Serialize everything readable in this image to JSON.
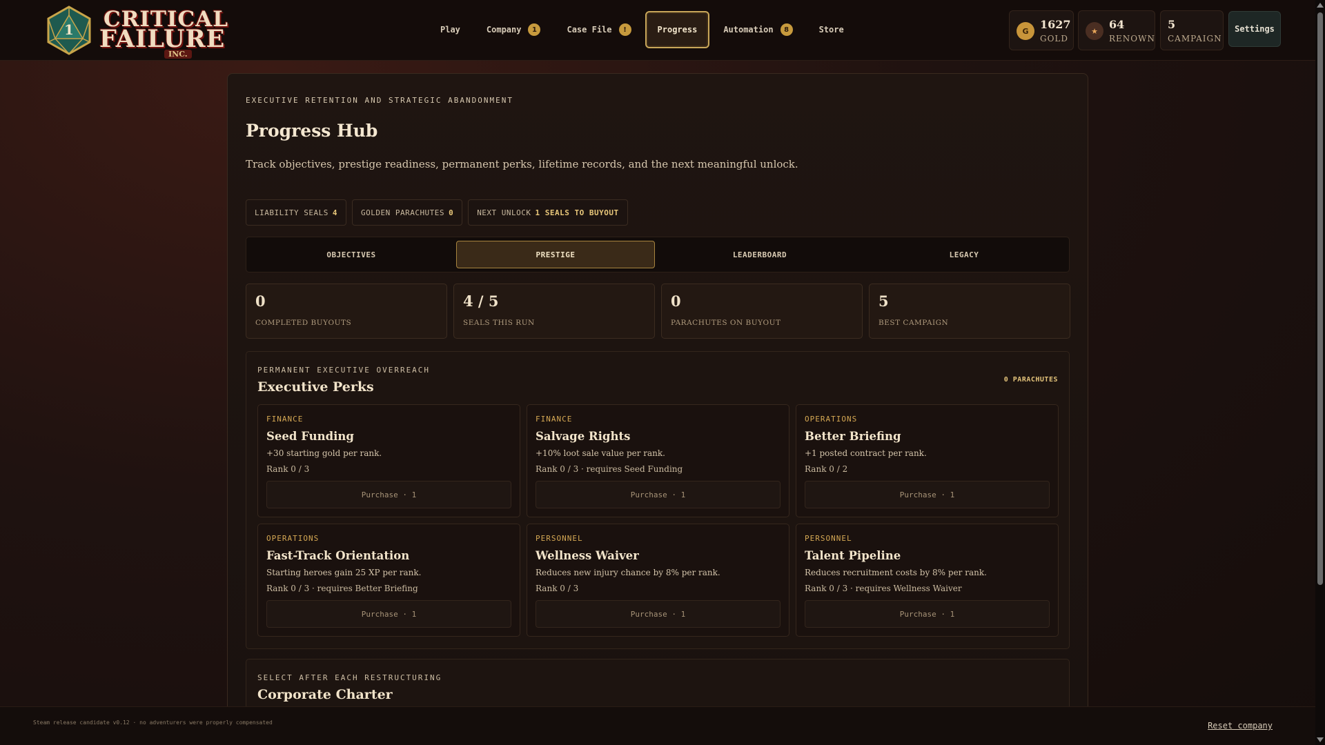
{
  "logo": {
    "line1": "CRITICAL",
    "line2": "FAILURE",
    "inc": "INC.",
    "die_number": "1"
  },
  "nav": [
    {
      "label": "Play",
      "badge": ""
    },
    {
      "label": "Company",
      "badge": "1"
    },
    {
      "label": "Case File",
      "badge": "!"
    },
    {
      "label": "Progress",
      "badge": "",
      "active": true
    },
    {
      "label": "Automation",
      "badge": "8"
    },
    {
      "label": "Store",
      "badge": ""
    }
  ],
  "stats": {
    "gold": {
      "value": "1627",
      "label": "GOLD",
      "icon": "G"
    },
    "renown": {
      "value": "64",
      "label": "RENOWN",
      "icon": "★"
    },
    "campaign": {
      "value": "5",
      "label": "CAMPAIGN"
    }
  },
  "settings_label": "Settings",
  "hub": {
    "eyebrow": "EXECUTIVE RETENTION AND STRATEGIC ABANDONMENT",
    "title": "Progress Hub",
    "description": "Track objectives, prestige readiness, permanent perks, lifetime records, and the next meaningful unlock.",
    "chips": [
      {
        "label": "LIABILITY SEALS",
        "value": "4"
      },
      {
        "label": "GOLDEN PARACHUTES",
        "value": "0"
      },
      {
        "label": "NEXT UNLOCK",
        "value": "1 SEALS TO BUYOUT"
      }
    ],
    "tabs": [
      "OBJECTIVES",
      "PRESTIGE",
      "LEADERBOARD",
      "LEGACY"
    ],
    "stat_cards": [
      {
        "value": "0",
        "caption": "COMPLETED BUYOUTS"
      },
      {
        "value": "4 / 5",
        "caption": "SEALS THIS RUN"
      },
      {
        "value": "0",
        "caption": "PARACHUTES ON BUYOUT"
      },
      {
        "value": "5",
        "caption": "BEST CAMPAIGN"
      }
    ]
  },
  "perks": {
    "eyebrow": "PERMANENT EXECUTIVE OVERREACH",
    "heading": "Executive Perks",
    "count": "0 PARACHUTES",
    "items": [
      {
        "category": "FINANCE",
        "name": "Seed Funding",
        "desc": "+30 starting gold per rank.",
        "rank": "Rank 0 / 3",
        "button": "Purchase · 1"
      },
      {
        "category": "FINANCE",
        "name": "Salvage Rights",
        "desc": "+10% loot sale value per rank.",
        "rank": "Rank 0 / 3 · requires Seed Funding",
        "button": "Purchase · 1"
      },
      {
        "category": "OPERATIONS",
        "name": "Better Briefing",
        "desc": "+1 posted contract per rank.",
        "rank": "Rank 0 / 2",
        "button": "Purchase · 1"
      },
      {
        "category": "OPERATIONS",
        "name": "Fast-Track Orientation",
        "desc": "Starting heroes gain 25 XP per rank.",
        "rank": "Rank 0 / 3 · requires Better Briefing",
        "button": "Purchase · 1"
      },
      {
        "category": "PERSONNEL",
        "name": "Wellness Waiver",
        "desc": "Reduces new injury chance by 8% per rank.",
        "rank": "Rank 0 / 3",
        "button": "Purchase · 1"
      },
      {
        "category": "PERSONNEL",
        "name": "Talent Pipeline",
        "desc": "Reduces recruitment costs by 8% per rank.",
        "rank": "Rank 0 / 3 · requires Wellness Waiver",
        "button": "Purchase · 1"
      }
    ]
  },
  "charter": {
    "eyebrow": "SELECT AFTER EACH RESTRUCTURING",
    "heading": "Corporate Charter"
  },
  "footer": {
    "note": "Steam release candidate v0.12 · no adventurers were properly compensated",
    "reset": "Reset company"
  }
}
